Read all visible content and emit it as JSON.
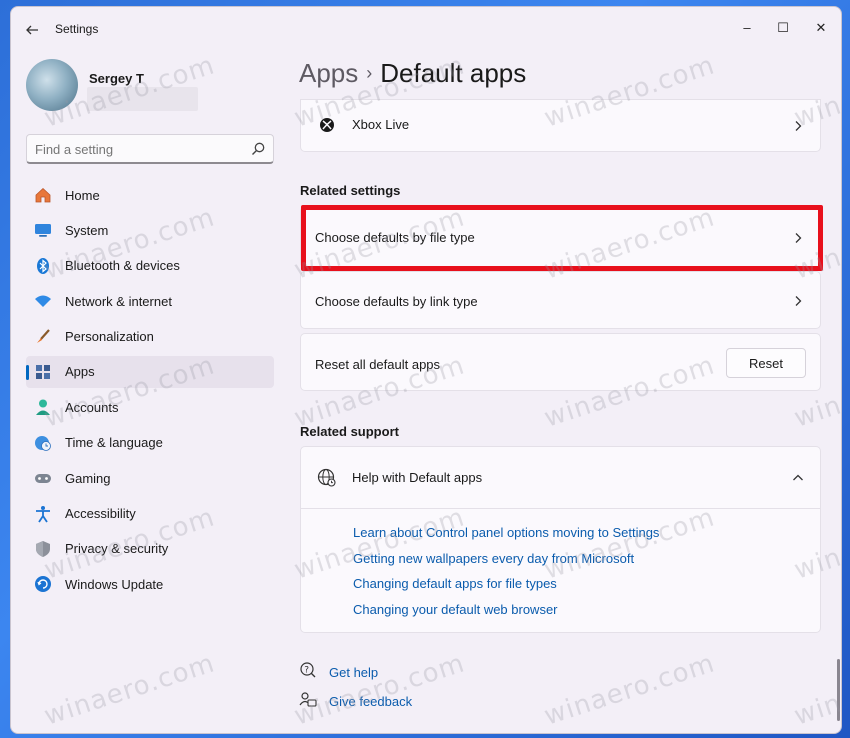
{
  "window": {
    "app_title": "Settings",
    "controls": {
      "minimize": "–",
      "maximize": "☐",
      "close": "✕"
    }
  },
  "user": {
    "name": "Sergey T"
  },
  "search": {
    "placeholder": "Find a setting"
  },
  "sidebar": {
    "items": [
      {
        "label": "Home",
        "icon": "home-icon"
      },
      {
        "label": "System",
        "icon": "system-icon"
      },
      {
        "label": "Bluetooth & devices",
        "icon": "bluetooth-icon"
      },
      {
        "label": "Network & internet",
        "icon": "wifi-icon"
      },
      {
        "label": "Personalization",
        "icon": "brush-icon"
      },
      {
        "label": "Apps",
        "icon": "apps-icon",
        "active": true
      },
      {
        "label": "Accounts",
        "icon": "person-icon"
      },
      {
        "label": "Time & language",
        "icon": "globe-clock-icon"
      },
      {
        "label": "Gaming",
        "icon": "gamepad-icon"
      },
      {
        "label": "Accessibility",
        "icon": "accessibility-icon"
      },
      {
        "label": "Privacy & security",
        "icon": "shield-icon"
      },
      {
        "label": "Windows Update",
        "icon": "update-icon"
      }
    ]
  },
  "breadcrumb": {
    "parent": "Apps",
    "separator": "›",
    "current": "Default apps"
  },
  "main": {
    "xbox_row": {
      "label": "Xbox Live"
    },
    "related_settings": {
      "title": "Related settings",
      "items": [
        {
          "label": "Choose defaults by file type"
        },
        {
          "label": "Choose defaults by link type"
        },
        {
          "label": "Reset all default apps",
          "button": "Reset"
        }
      ]
    },
    "related_support": {
      "title": "Related support",
      "help_title": "Help with Default apps",
      "links": [
        "Learn about Control panel options moving to Settings",
        "Getting new wallpapers every day from Microsoft",
        "Changing default apps for file types",
        "Changing your default web browser"
      ]
    },
    "footer": {
      "get_help": "Get help",
      "give_feedback": "Give feedback"
    }
  },
  "colors": {
    "accent": "#0067c0",
    "link": "#0b5cad",
    "highlight": "#e8101c",
    "window_bg": "#f3eff7",
    "card_bg": "#fbf9fd"
  },
  "watermark": "winaero.com"
}
